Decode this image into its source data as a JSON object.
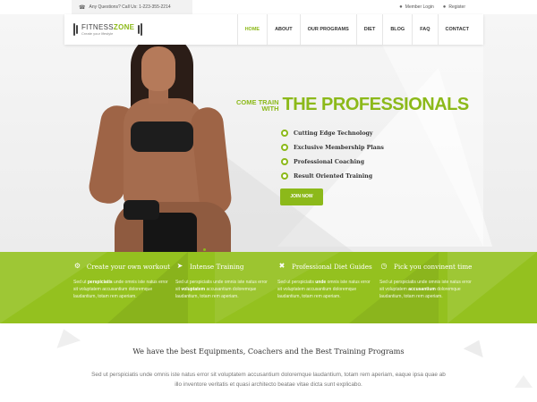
{
  "topbar": {
    "contact_text": "Any Questions? Call Us: 1-223-355-2214",
    "member_login": "Member Login",
    "register": "Register"
  },
  "logo": {
    "name_part1": "FITNESS",
    "name_part2": "ZONE",
    "tagline": "Create your lifestyle"
  },
  "nav": {
    "items": [
      "HOME",
      "ABOUT",
      "OUR PROGRAMS",
      "DIET",
      "BLOG",
      "FAQ",
      "CONTACT"
    ],
    "active_index": 0
  },
  "hero": {
    "pre_line1": "COME TRAIN",
    "pre_line2": "WITH",
    "title": "THE PROFESSIONALS",
    "features": [
      "Cutting Edge Technology",
      "Exclusive Membership Plans",
      "Professional Coaching",
      "Result Oriented Training"
    ],
    "button_label": "JOIN NOW"
  },
  "services": [
    {
      "icon": "gear-icon",
      "title": "Create your own workout",
      "text_before": "Sed ut ",
      "text_bold": "perspiciatis",
      "text_after": " unde omnis iste natus error sit voluptatem accusantium doloremque laudantium, totam rem aperiam."
    },
    {
      "icon": "rocket-icon",
      "title": "Intense Training",
      "text_before": "Sed ut perspiciatis unde omnis iste natus error sit ",
      "text_bold": "voluptatem",
      "text_after": " accusantium doloremque laudantium, totam rem aperiam."
    },
    {
      "icon": "cutlery-icon",
      "title": "Professional Diet Guides",
      "text_before": "Sed ut perspiciatis ",
      "text_bold": "unde",
      "text_after": " omnis iste natus error sit voluptatem accusantium doloremque laudantium, totam rem aperiam."
    },
    {
      "icon": "clock-icon",
      "title": "Pick you convinent time",
      "text_before": "Sed ut perspiciatis unde omnis iste natus error sit voluptatem ",
      "text_bold": "accusantium",
      "text_after": " doloremque laudantium, totam rem aperiam."
    }
  ],
  "bottom": {
    "title": "We have the best Equipments, Coachers and the Best Training Programs",
    "text": "Sed ut perspiciatis unde omnis iste natus error sit voluptatem accusantium doloremque laudantium, totam rem aperiam, eaque ipsa quae ab illo inventore veritatis et quasi architecto beatae vitae dicta sunt explicabo."
  },
  "colors": {
    "accent": "#8cb91a",
    "band": "#94c11f"
  }
}
